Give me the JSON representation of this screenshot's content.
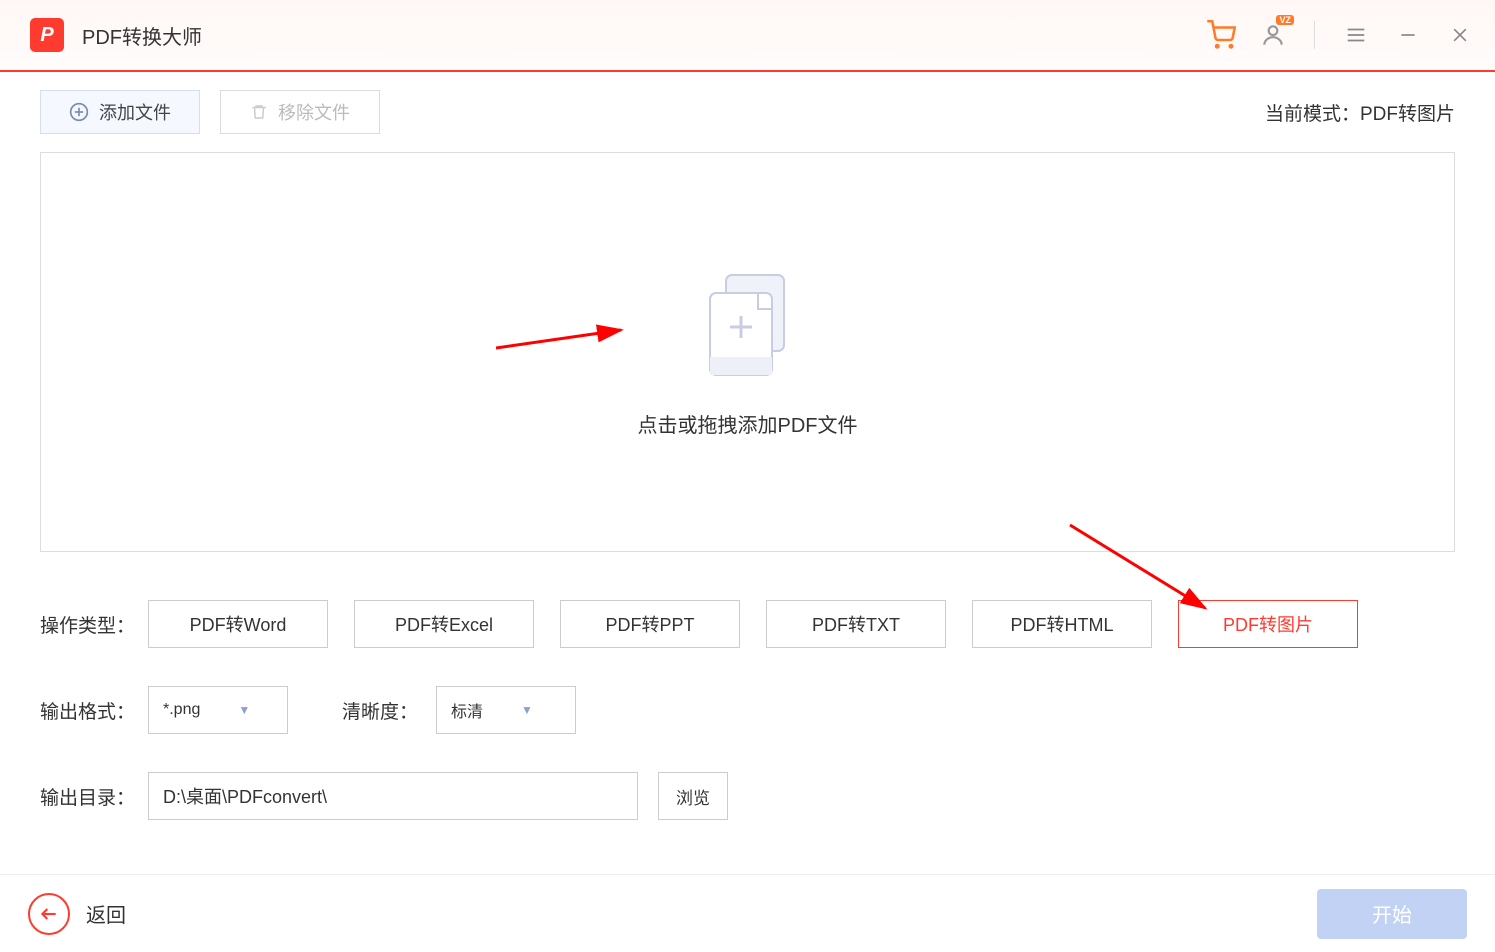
{
  "header": {
    "app_title": "PDF转换大师",
    "logo_letter": "P"
  },
  "toolbar": {
    "add_file": "添加文件",
    "remove_file": "移除文件",
    "mode_prefix": "当前模式：",
    "mode_value": "PDF转图片"
  },
  "dropzone": {
    "hint": "点击或拖拽添加PDF文件"
  },
  "operation": {
    "label": "操作类型：",
    "types": [
      "PDF转Word",
      "PDF转Excel",
      "PDF转PPT",
      "PDF转TXT",
      "PDF转HTML",
      "PDF转图片"
    ]
  },
  "output_format": {
    "label": "输出格式：",
    "value": "*.png"
  },
  "clarity": {
    "label": "清晰度：",
    "value": "标清"
  },
  "output_dir": {
    "label": "输出目录：",
    "value": "D:\\桌面\\PDFconvert\\",
    "browse": "浏览"
  },
  "footer": {
    "back": "返回",
    "start": "开始"
  },
  "user_badge": "VZ"
}
